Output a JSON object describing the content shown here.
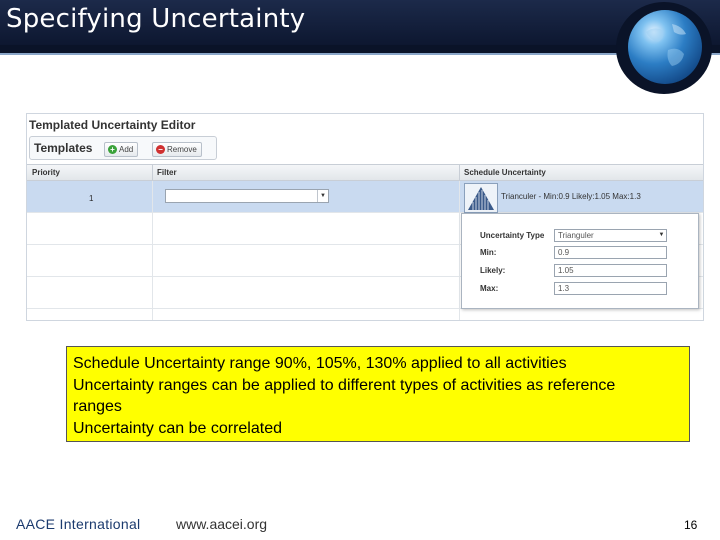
{
  "slide": {
    "title": "Specifying Uncertainty",
    "page_number": "16"
  },
  "editor": {
    "title": "Templated Uncertainty Editor",
    "templates_label": "Templates",
    "add_label": "Add",
    "remove_label": "Remove",
    "columns": [
      "Priority",
      "Filter",
      "Schedule Uncertainty"
    ],
    "row": {
      "priority": "1",
      "uncertainty_summary": "Trianculer - Min:0.9 Likely:1.05 Max:1.3"
    },
    "popup": {
      "type_label": "Uncertainty Type",
      "type_value": "Trianguler",
      "min_label": "Min:",
      "min_value": "0.9",
      "likely_label": "Likely:",
      "likely_value": "1.05",
      "max_label": "Max:",
      "max_value": "1.3"
    }
  },
  "note": {
    "lines": [
      "Schedule Uncertainty range 90%, 105%, 130% applied to all activities",
      "Uncertainty ranges can be applied to different types of activities as reference",
      "ranges",
      "Uncertainty can be correlated"
    ]
  },
  "footer": {
    "org": "AACE International",
    "url": "www.aacei.org"
  },
  "icons": {
    "add": "plus-circle-icon",
    "remove": "minus-circle-icon",
    "dropdown": "chevron-down-icon",
    "triangular": "triangular-distribution-icon",
    "logo": "globe-icon"
  },
  "colors": {
    "header": "#1c2a4a",
    "note_background": "#ffff00",
    "selected_row": "#c9daf0",
    "add_icon": "#3aa23a",
    "remove_icon": "#d03030"
  }
}
